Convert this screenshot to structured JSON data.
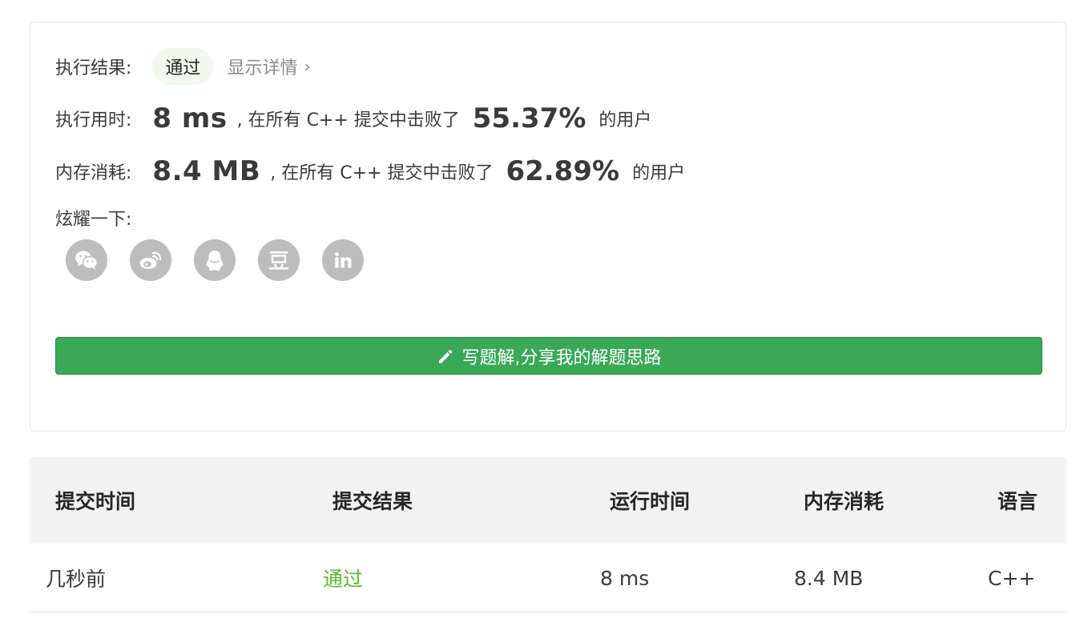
{
  "result": {
    "label": "执行结果:",
    "status": "通过",
    "details_link": "显示详情",
    "details_chevron": "›"
  },
  "runtime": {
    "label": "执行用时:",
    "value": "8 ms",
    "middle_text": ", 在所有 C++ 提交中击败了",
    "percent": "55.37%",
    "tail_text": "的用户"
  },
  "memory": {
    "label": "内存消耗:",
    "value": "8.4 MB",
    "middle_text": ", 在所有 C++ 提交中击败了",
    "percent": "62.89%",
    "tail_text": "的用户"
  },
  "share": {
    "label": "炫耀一下:",
    "icons": [
      "wechat-icon",
      "weibo-icon",
      "qq-icon",
      "douban-icon",
      "linkedin-icon"
    ]
  },
  "solution_button": {
    "label": "写题解,分享我的解题思路",
    "icon": "pencil-icon"
  },
  "table": {
    "headers": [
      "提交时间",
      "提交结果",
      "运行时间",
      "内存消耗",
      "语言"
    ],
    "rows": [
      {
        "time": "几秒前",
        "status": "通过",
        "runtime": "8 ms",
        "memory": "8.4 MB",
        "language": "C++"
      }
    ]
  },
  "colors": {
    "accent_green": "#3aa857",
    "status_green": "#5db734",
    "pill_bg": "#f2f8ee",
    "icon_gray": "#bdbdbd"
  }
}
